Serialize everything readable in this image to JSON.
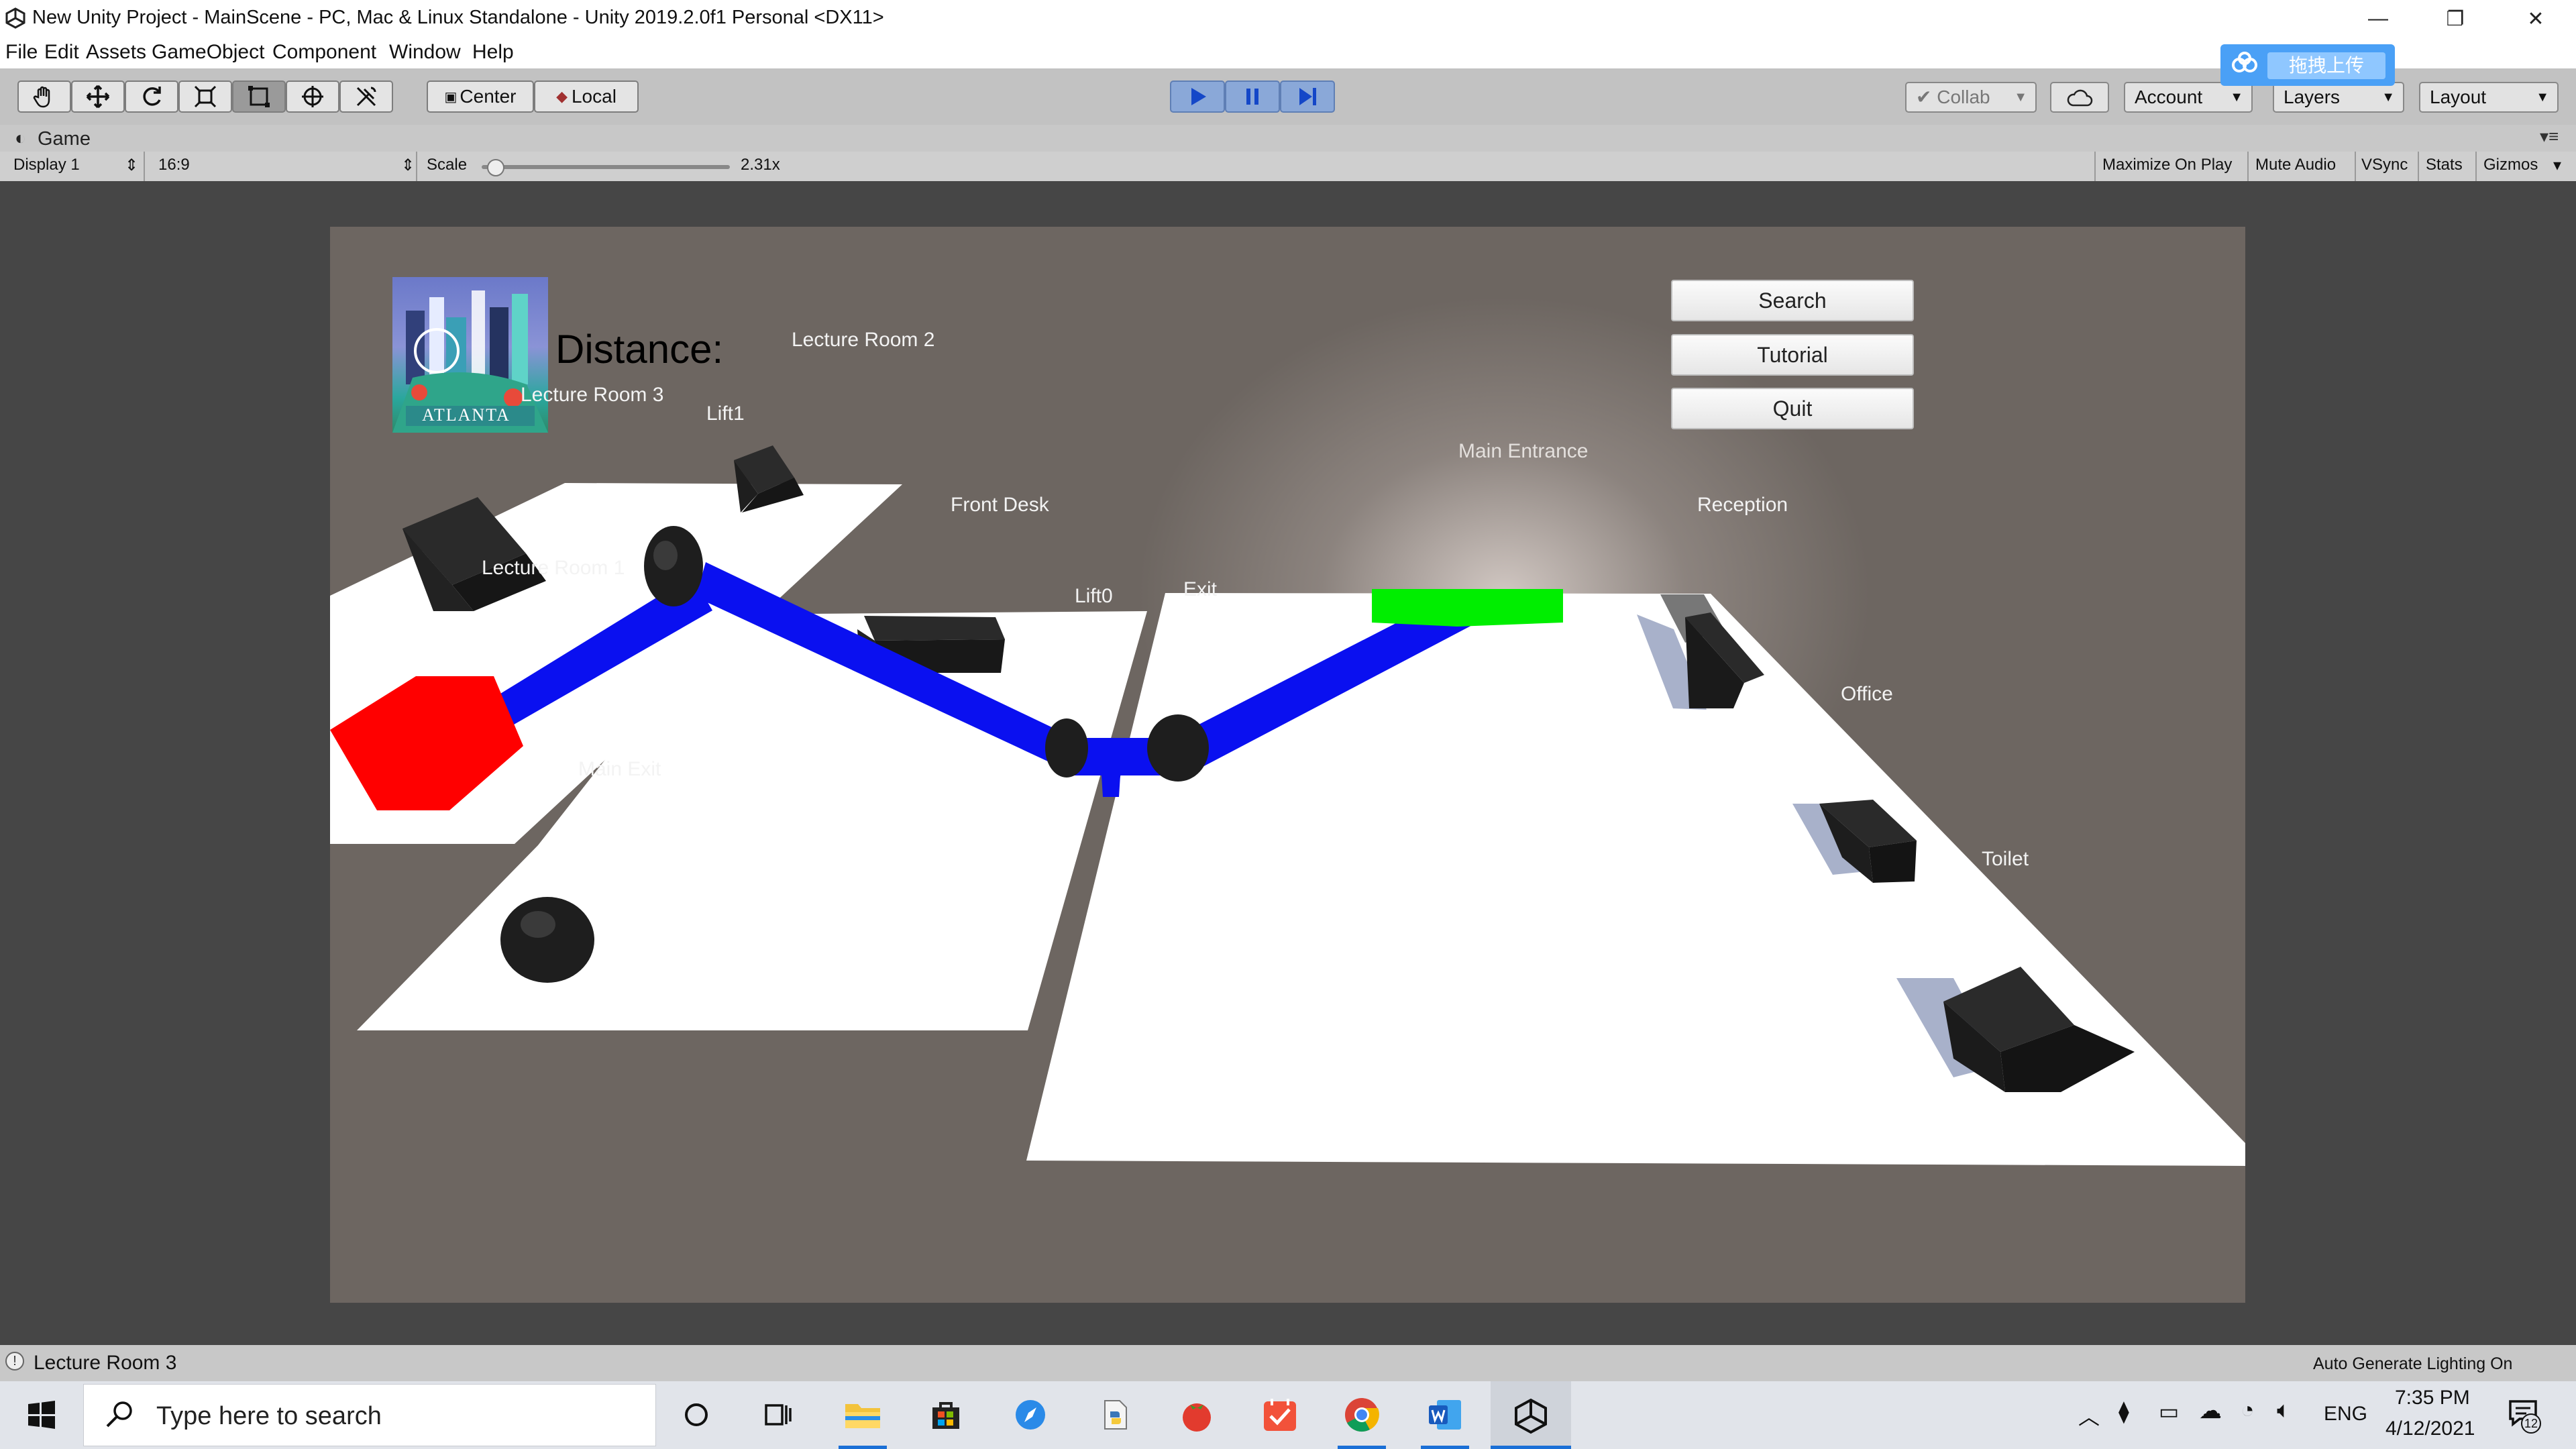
{
  "window": {
    "title": "New Unity Project - MainScene - PC, Mac & Linux Standalone - Unity 2019.2.0f1 Personal <DX11>",
    "minimize": "—",
    "restore": "❐",
    "close": "✕"
  },
  "menu": [
    "File",
    "Edit",
    "Assets",
    "GameObject",
    "Component",
    "Window",
    "Help"
  ],
  "toolbar": {
    "center_label": "Center",
    "local_label": "Local",
    "collab_label": "Collab",
    "account_label": "Account",
    "layers_label": "Layers",
    "layout_label": "Layout",
    "upload_popup": "拖拽上传"
  },
  "game_tab": {
    "tab_label": "Game",
    "display": "Display 1",
    "aspect": "16:9",
    "scale_label": "Scale",
    "scale_value": "2.31x",
    "scale_level": 0.05,
    "maximize_on_play": "Maximize On Play",
    "mute_audio": "Mute Audio",
    "vsync": "VSync",
    "stats": "Stats",
    "gizmos": "Gizmos"
  },
  "scene": {
    "distance_label": "Distance:",
    "logo_text": "ATLANTA",
    "buttons": {
      "search": "Search",
      "tutorial": "Tutorial",
      "quit": "Quit"
    },
    "labels": {
      "lecture_room_2": "Lecture Room 2",
      "lecture_room_3": "Lecture Room 3",
      "lift1": "Lift1",
      "front_desk": "Front Desk",
      "main_entrance": "Main Entrance",
      "reception": "Reception",
      "lecture_room_1": "Lecture Room 1",
      "lift0": "Lift0",
      "exit": "Exit",
      "office": "Office",
      "main_exit": "Main Exit",
      "toilet": "Toilet"
    },
    "colors": {
      "path": "#0a10f0",
      "start_marker": "#ff0000",
      "end_marker": "#00ee00",
      "floor": "#ffffff",
      "background": "#6d6661"
    }
  },
  "status": {
    "message": "Lecture Room 3",
    "lighting": "Auto Generate Lighting On"
  },
  "taskbar": {
    "search_placeholder": "Type here to search",
    "language": "ENG",
    "time": "7:35 PM",
    "date": "4/12/2021",
    "notification_count": "12"
  }
}
